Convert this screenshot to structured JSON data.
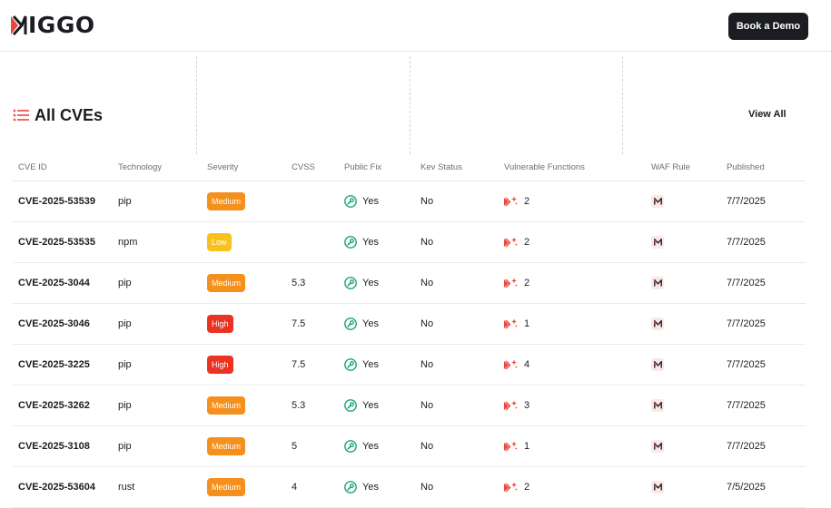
{
  "header": {
    "logo_text": "IGGO",
    "cta_label": "Book a Demo"
  },
  "section": {
    "title": "All CVEs",
    "view_all": "View All",
    "icon": "list-icon"
  },
  "table": {
    "columns": [
      "CVE ID",
      "Technology",
      "Severity",
      "CVSS",
      "Public Fix",
      "Kev Status",
      "Vulnerable Functions",
      "WAF Rule",
      "Published"
    ],
    "rows": [
      {
        "id": "CVE-2025-53539",
        "tech": "pip",
        "severity": "Medium",
        "cvss": "",
        "fix": "Yes",
        "kev": "No",
        "vf": "2",
        "published": "7/7/2025"
      },
      {
        "id": "CVE-2025-53535",
        "tech": "npm",
        "severity": "Low",
        "cvss": "",
        "fix": "Yes",
        "kev": "No",
        "vf": "2",
        "published": "7/7/2025"
      },
      {
        "id": "CVE-2025-3044",
        "tech": "pip",
        "severity": "Medium",
        "cvss": "5.3",
        "fix": "Yes",
        "kev": "No",
        "vf": "2",
        "published": "7/7/2025"
      },
      {
        "id": "CVE-2025-3046",
        "tech": "pip",
        "severity": "High",
        "cvss": "7.5",
        "fix": "Yes",
        "kev": "No",
        "vf": "1",
        "published": "7/7/2025"
      },
      {
        "id": "CVE-2025-3225",
        "tech": "pip",
        "severity": "High",
        "cvss": "7.5",
        "fix": "Yes",
        "kev": "No",
        "vf": "4",
        "published": "7/7/2025"
      },
      {
        "id": "CVE-2025-3262",
        "tech": "pip",
        "severity": "Medium",
        "cvss": "5.3",
        "fix": "Yes",
        "kev": "No",
        "vf": "3",
        "published": "7/7/2025"
      },
      {
        "id": "CVE-2025-3108",
        "tech": "pip",
        "severity": "Medium",
        "cvss": "5",
        "fix": "Yes",
        "kev": "No",
        "vf": "1",
        "published": "7/7/2025"
      },
      {
        "id": "CVE-2025-53604",
        "tech": "rust",
        "severity": "Medium",
        "cvss": "4",
        "fix": "Yes",
        "kev": "No",
        "vf": "2",
        "published": "7/5/2025"
      }
    ]
  },
  "colors": {
    "Medium": "#f5901d",
    "Low": "#f8c21b",
    "High": "#ea3323",
    "brand": "#e8473f",
    "fix_green": "#1aa574",
    "dark": "#1c1d22"
  },
  "icons": {
    "fix": "wrench-icon",
    "vulnerable_functions": "sparkle-function-icon",
    "waf": "miggo-waf-icon",
    "logo": "miggo-logo-icon"
  }
}
